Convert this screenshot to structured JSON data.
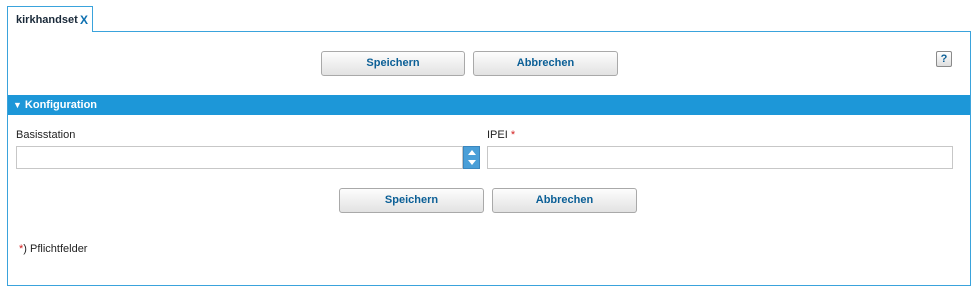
{
  "tab": {
    "label": "kirkhandset",
    "close": "X"
  },
  "toolbar": {
    "save_label": "Speichern",
    "cancel_label": "Abbrechen",
    "help_label": "?"
  },
  "section": {
    "title": "Konfiguration",
    "chevron": "▼"
  },
  "form": {
    "basisstation_label": "Basisstation",
    "basisstation_value": "",
    "ipei_label": "IPEI",
    "ipei_required": "*",
    "ipei_value": ""
  },
  "footer_buttons": {
    "save_label": "Speichern",
    "cancel_label": "Abbrechen"
  },
  "note": {
    "star": "*",
    "text": ") Pflichtfelder"
  },
  "colors": {
    "accent": "#1d97d8",
    "required": "#d21f1f",
    "button_text": "#0b5f96"
  },
  "icons": {
    "help": "question-icon",
    "spinner_up": "arrow-up-icon",
    "spinner_down": "arrow-down-icon",
    "section_toggle": "chevron-down-icon"
  }
}
